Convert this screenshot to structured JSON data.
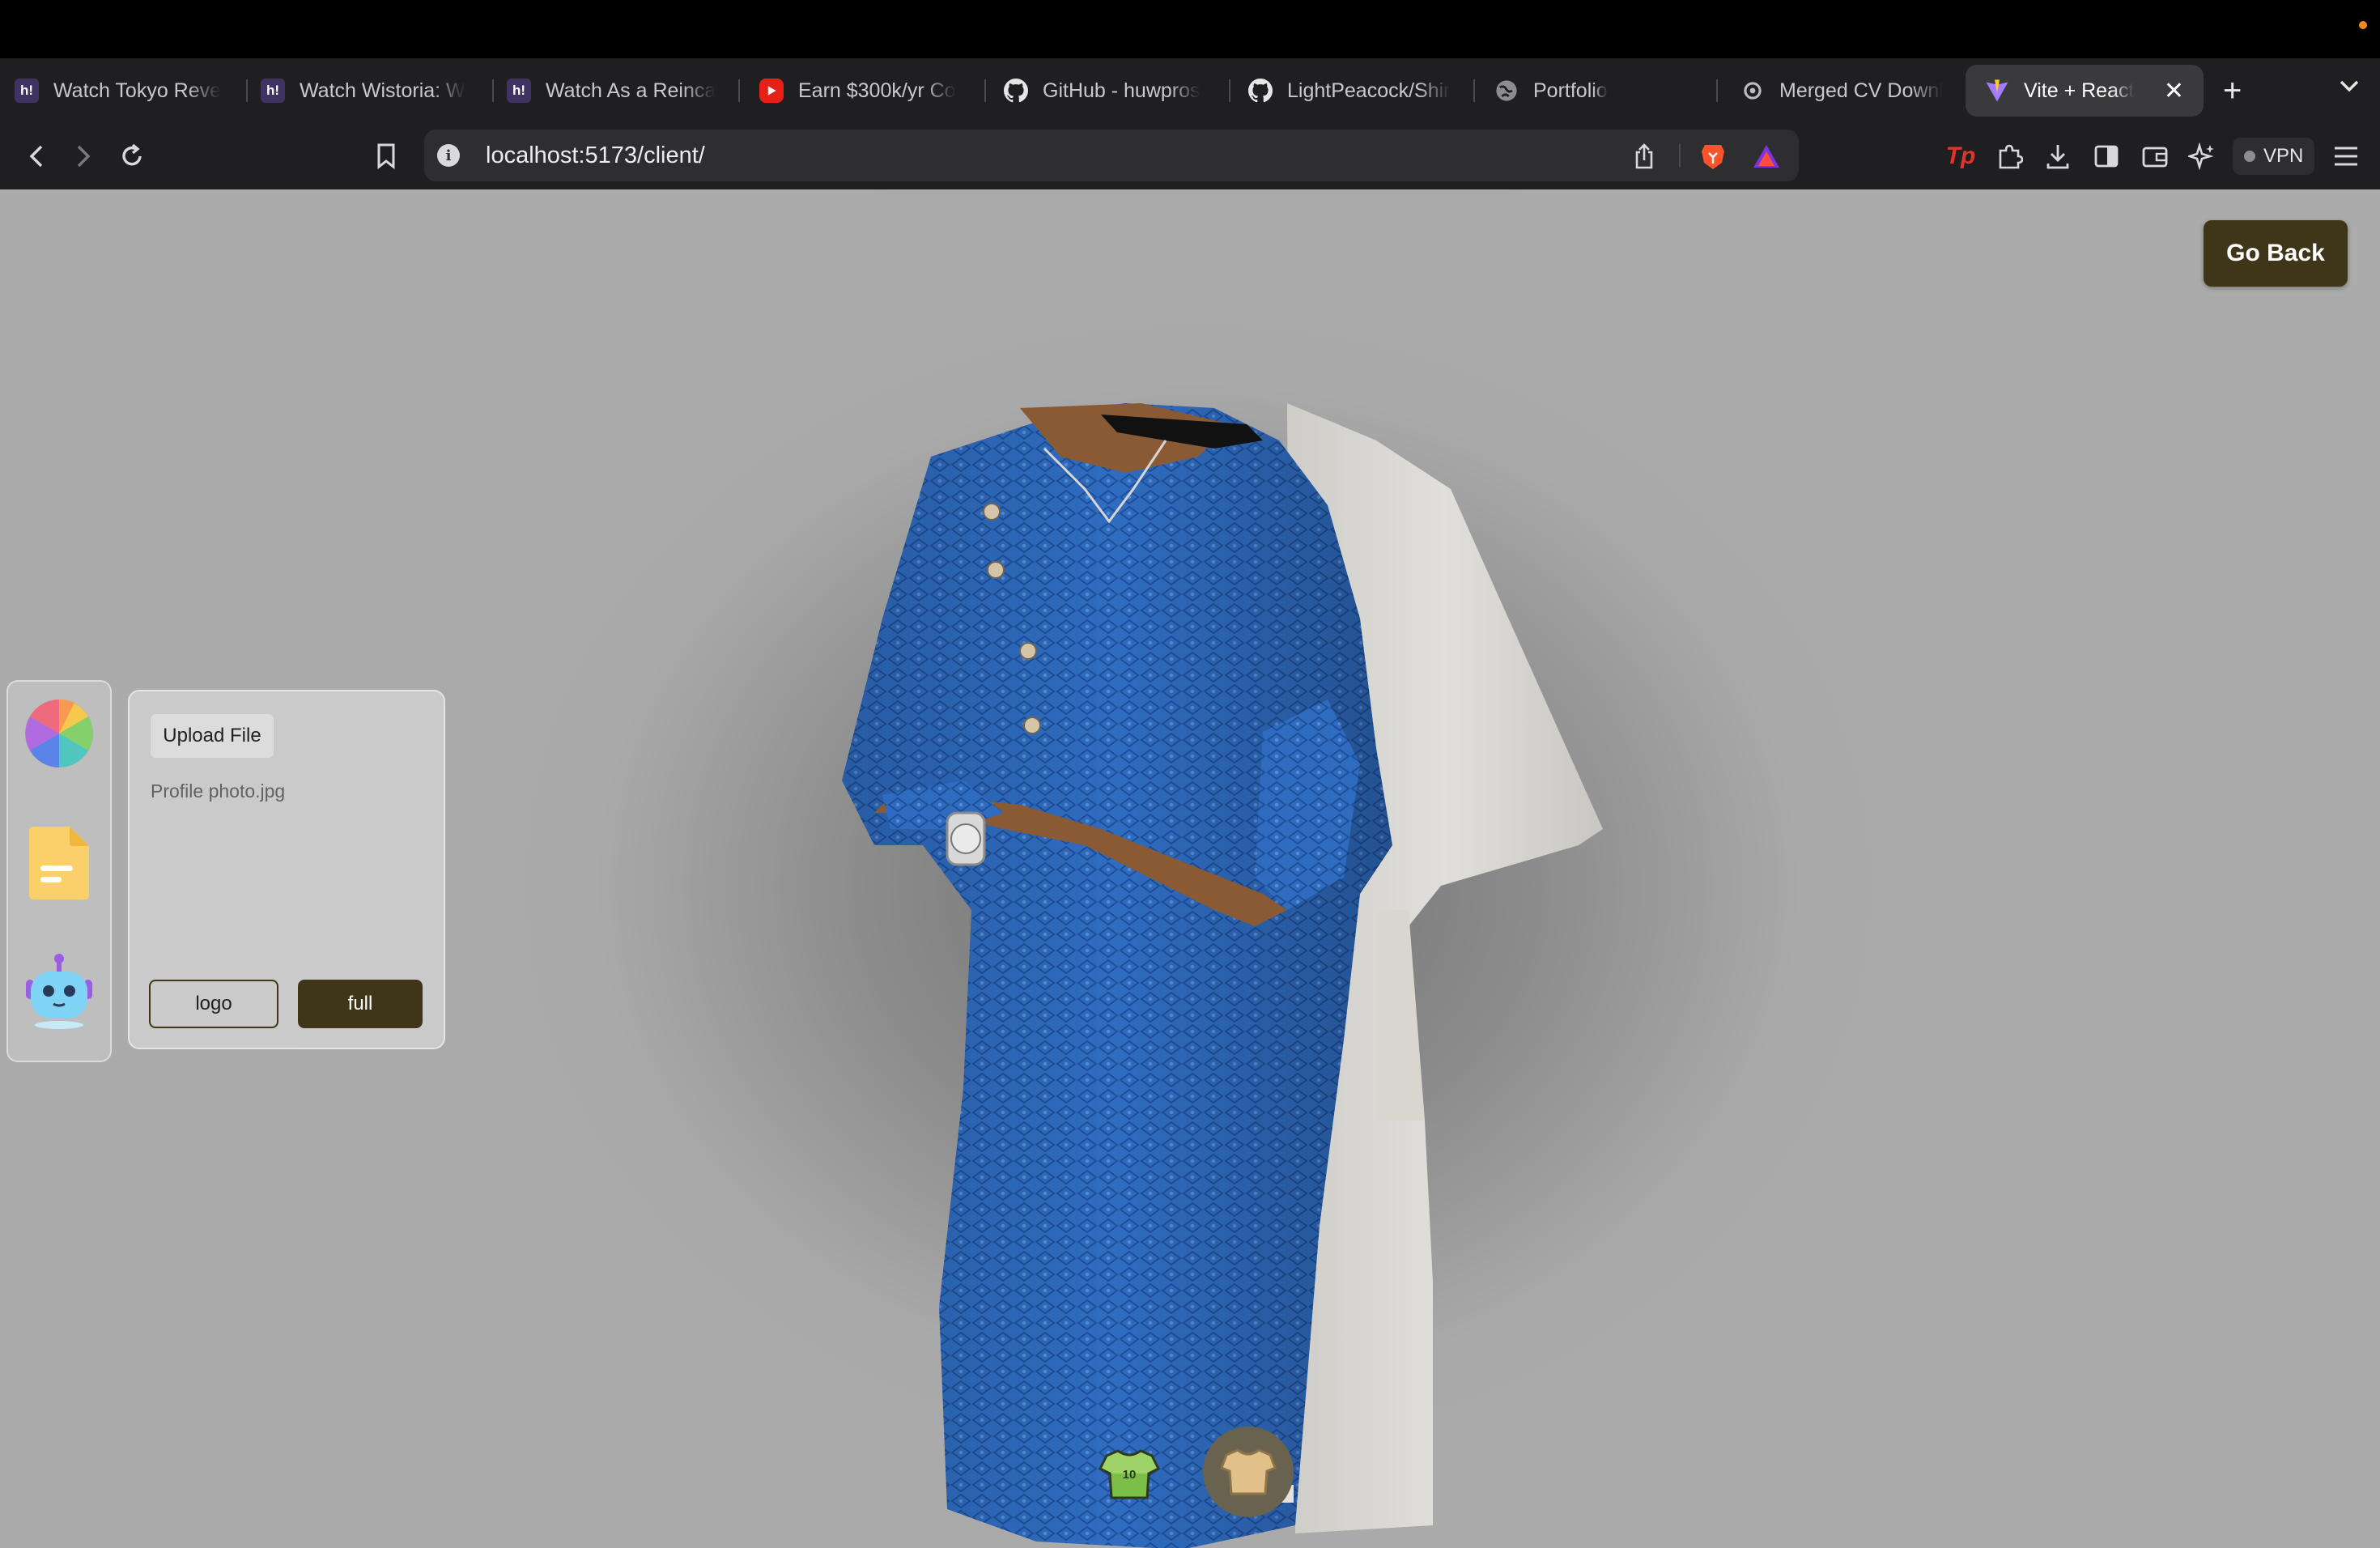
{
  "browser": {
    "tabs": [
      {
        "title": "Watch Tokyo Reve",
        "favicon": "hianime-icon"
      },
      {
        "title": "Watch Wistoria: W",
        "favicon": "hianime-icon"
      },
      {
        "title": "Watch As a Reinca",
        "favicon": "hianime-icon"
      },
      {
        "title": "Earn $300k/yr Co",
        "favicon": "youtube-icon"
      },
      {
        "title": "GitHub - huwpros",
        "favicon": "github-icon"
      },
      {
        "title": "LightPeacock/Shir",
        "favicon": "github-icon"
      },
      {
        "title": "Portfolio",
        "favicon": "globe-icon"
      },
      {
        "title": "Merged CV Downl",
        "favicon": "openai-icon"
      },
      {
        "title": "Vite + React",
        "favicon": "vite-icon",
        "active": true
      }
    ],
    "new_tab": "+",
    "url": "localhost:5173/client/",
    "vpn_label": "VPN",
    "accent": "#f08a1f"
  },
  "page": {
    "go_back_label": "Go Back",
    "tools": [
      {
        "name": "color-picker",
        "icon": "color-wheel-icon"
      },
      {
        "name": "file-picker",
        "icon": "file-icon"
      },
      {
        "name": "ai-picker",
        "icon": "robot-icon"
      }
    ],
    "file_panel": {
      "upload_label": "Upload File",
      "file_name": "Profile photo.jpg",
      "logo_label": "logo",
      "full_label": "full"
    },
    "bottom_tabs": [
      {
        "name": "logo-shirt",
        "icon": "jersey-icon",
        "number": "10"
      },
      {
        "name": "stylish-shirt",
        "icon": "tshirt-icon",
        "active": true
      }
    ],
    "colors": {
      "brand_dark": "#3f361a",
      "shirt_blue": "#2f6cc0"
    }
  }
}
